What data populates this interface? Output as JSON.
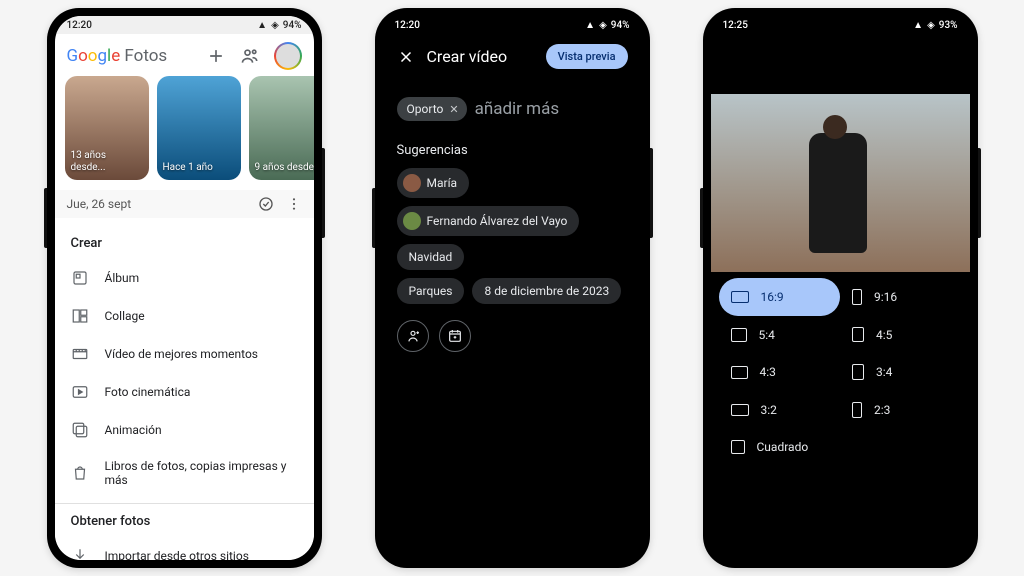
{
  "phone1": {
    "status": {
      "time": "12:20",
      "battery": "94%"
    },
    "header": {
      "brand_rest": " Fotos"
    },
    "memories": [
      {
        "label": "13 años desde..."
      },
      {
        "label": "Hace 1 año"
      },
      {
        "label": "9 años desde..."
      }
    ],
    "date_row": "Jue, 26 sept",
    "sheet": {
      "title": "Crear",
      "items": [
        {
          "label": "Álbum"
        },
        {
          "label": "Collage"
        },
        {
          "label": "Vídeo de mejores momentos"
        },
        {
          "label": "Foto cinemática"
        },
        {
          "label": "Animación"
        },
        {
          "label": "Libros de fotos, copias impresas y más"
        }
      ],
      "section2_title": "Obtener fotos",
      "section2_item": "Importar desde otros sitios"
    }
  },
  "phone2": {
    "status": {
      "time": "12:20",
      "battery": "94%"
    },
    "header": {
      "title": "Crear vídeo",
      "preview_btn": "Vista previa"
    },
    "chip": {
      "label": "Oporto"
    },
    "hint": "añadir más",
    "section_label": "Sugerencias",
    "suggestions": {
      "maria": "María",
      "fernando": "Fernando Álvarez del Vayo",
      "navidad": "Navidad",
      "parques": "Parques",
      "fecha": "8 de diciembre de 2023"
    }
  },
  "phone3": {
    "status": {
      "time": "12:25",
      "battery": "93%"
    },
    "ratios": {
      "r16_9": "16:9",
      "r9_16": "9:16",
      "r5_4": "5:4",
      "r4_5": "4:5",
      "r4_3": "4:3",
      "r3_4": "3:4",
      "r3_2": "3:2",
      "r2_3": "2:3",
      "square": "Cuadrado"
    }
  }
}
